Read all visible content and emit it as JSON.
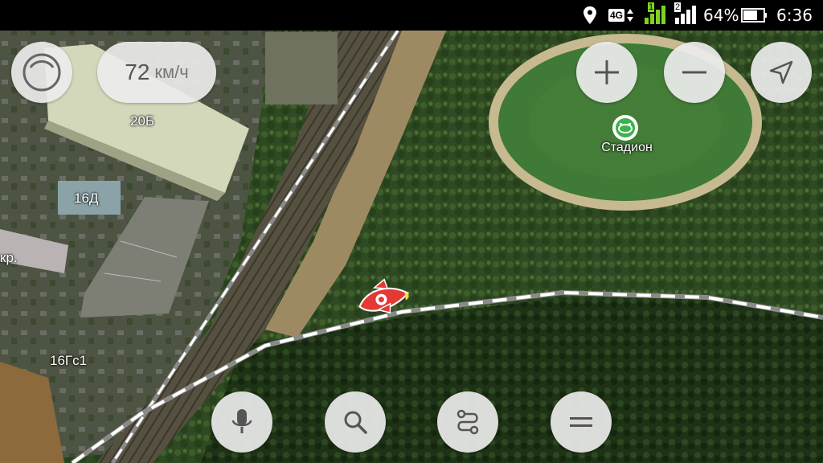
{
  "status_bar": {
    "network": "4G",
    "sim1": "1",
    "sim2": "2",
    "battery": "64%",
    "time": "6:36"
  },
  "speed": {
    "value": "72",
    "unit": "км/ч"
  },
  "map_labels": {
    "b20": "20Б",
    "b16d": "16Д",
    "kr": "кр.",
    "b16gc1": "16Гс1"
  },
  "poi": {
    "label": "Стадион",
    "icon": "stadium-icon",
    "color": "#3cb34a"
  },
  "controls": {
    "compass": "compass-icon",
    "zoom_in": "plus-icon",
    "zoom_out": "minus-icon",
    "locate": "navigation-arrow-icon"
  },
  "bottom_bar": {
    "voice": "microphone-icon",
    "search": "search-icon",
    "routes": "route-icon",
    "menu": "menu-icon"
  },
  "colors": {
    "vehicle": "#e53935",
    "track_dash": "#ffffff"
  }
}
